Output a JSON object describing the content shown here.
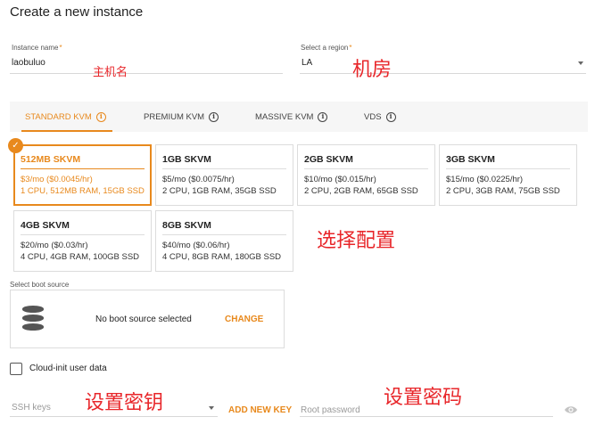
{
  "page": {
    "title": "Create a new instance"
  },
  "instance_name": {
    "label": "Instance name",
    "required_mark": "*",
    "value": "laobuluo",
    "annotation": "主机名"
  },
  "region": {
    "label": "Select a region",
    "required_mark": "*",
    "value": "LA",
    "annotation": "机房"
  },
  "tabs": [
    {
      "label": "STANDARD KVM",
      "active": true
    },
    {
      "label": "PREMIUM KVM",
      "active": false
    },
    {
      "label": "MASSIVE KVM",
      "active": false
    },
    {
      "label": "VDS",
      "active": false
    }
  ],
  "plans": [
    {
      "name": "512MB SKVM",
      "price": "$3/mo ($0.0045/hr)",
      "specs": "1 CPU, 512MB RAM, 15GB SSD",
      "selected": true
    },
    {
      "name": "1GB SKVM",
      "price": "$5/mo ($0.0075/hr)",
      "specs": "2 CPU, 1GB RAM, 35GB SSD",
      "selected": false
    },
    {
      "name": "2GB SKVM",
      "price": "$10/mo ($0.015/hr)",
      "specs": "2 CPU, 2GB RAM, 65GB SSD",
      "selected": false
    },
    {
      "name": "3GB SKVM",
      "price": "$15/mo ($0.0225/hr)",
      "specs": "2 CPU, 3GB RAM, 75GB SSD",
      "selected": false
    },
    {
      "name": "4GB SKVM",
      "price": "$20/mo ($0.03/hr)",
      "specs": "4 CPU, 4GB RAM, 100GB SSD",
      "selected": false
    },
    {
      "name": "8GB SKVM",
      "price": "$40/mo ($0.06/hr)",
      "specs": "4 CPU, 8GB RAM, 180GB SSD",
      "selected": false
    }
  ],
  "plans_annotation": "选择配置",
  "boot_source": {
    "label": "Select boot source",
    "status": "No boot source selected",
    "change_label": "CHANGE"
  },
  "cloud_init": {
    "label": "Cloud-init user data",
    "checked": false
  },
  "ssh": {
    "label": "SSH keys",
    "add_label": "ADD NEW KEY",
    "annotation": "设置密钥"
  },
  "root_password": {
    "placeholder": "Root password",
    "annotation": "设置密码"
  },
  "colors": {
    "accent": "#e8891d",
    "annotation": "#e8262a"
  }
}
